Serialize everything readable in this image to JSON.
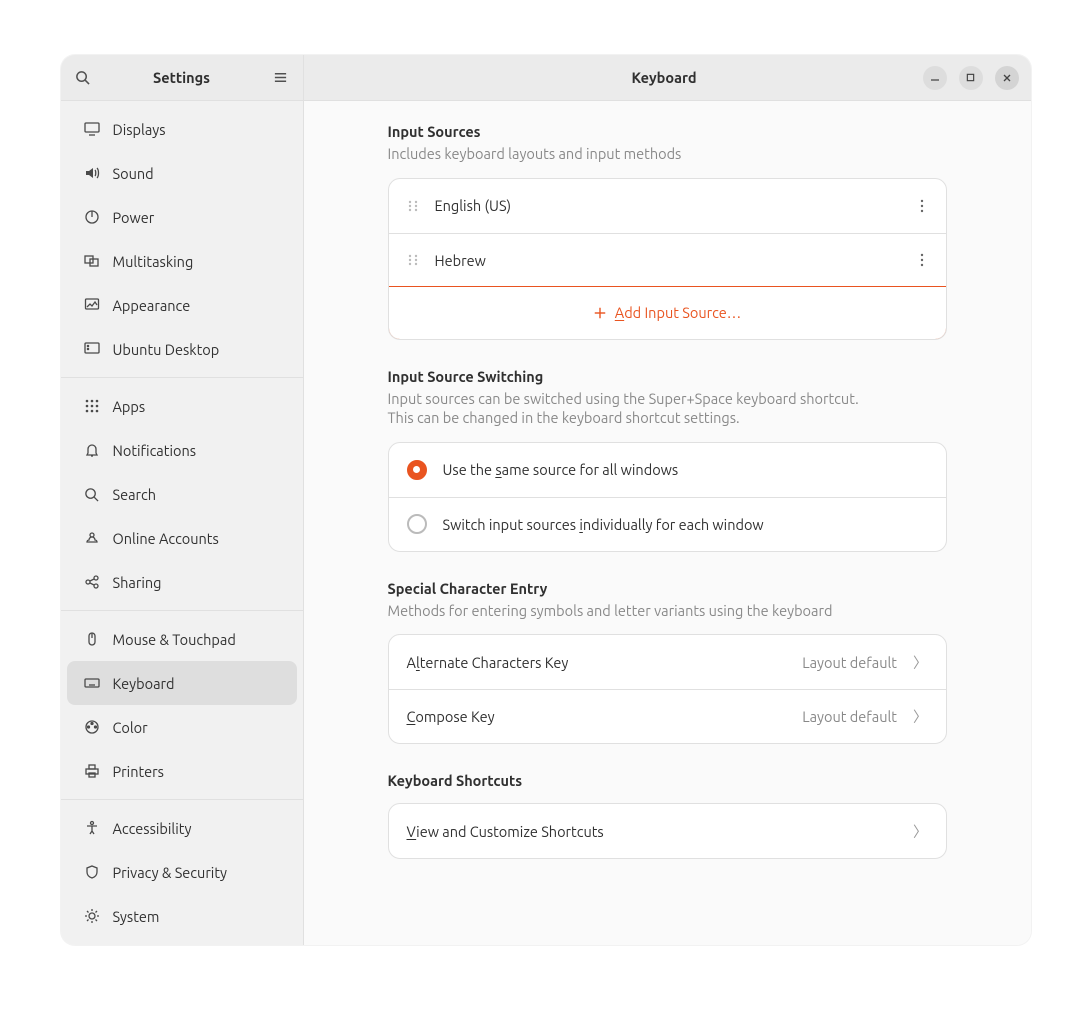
{
  "sidebar": {
    "title": "Settings",
    "groups": [
      [
        "Displays",
        "Sound",
        "Power",
        "Multitasking",
        "Appearance",
        "Ubuntu Desktop"
      ],
      [
        "Apps",
        "Notifications",
        "Search",
        "Online Accounts",
        "Sharing"
      ],
      [
        "Mouse & Touchpad",
        "Keyboard",
        "Color",
        "Printers"
      ],
      [
        "Accessibility",
        "Privacy & Security",
        "System"
      ]
    ],
    "selected": "Keyboard"
  },
  "header": {
    "title": "Keyboard"
  },
  "input_sources": {
    "title": "Input Sources",
    "desc": "Includes keyboard layouts and input methods",
    "items": [
      "English (US)",
      "Hebrew"
    ],
    "add_pre": "A",
    "add_post": "dd Input Source…"
  },
  "switching": {
    "title": "Input Source Switching",
    "desc1": "Input sources can be switched using the Super+Space keyboard shortcut.",
    "desc2": "This can be changed in the keyboard shortcut settings.",
    "opt1_pre": "Use the ",
    "opt1_u": "s",
    "opt1_post": "ame source for all windows",
    "opt2_pre": "Switch input sources ",
    "opt2_u": "i",
    "opt2_post": "ndividually for each window",
    "selected": 0
  },
  "special": {
    "title": "Special Character Entry",
    "desc": "Methods for entering symbols and letter variants using the keyboard",
    "rows": [
      {
        "pre": "A",
        "u": "l",
        "post": "ternate Characters Key",
        "value": "Layout default"
      },
      {
        "pre": "",
        "u": "C",
        "post": "ompose Key",
        "value": "Layout default"
      }
    ]
  },
  "shortcuts": {
    "title": "Keyboard Shortcuts",
    "row_pre": "",
    "row_u": "V",
    "row_post": "iew and Customize Shortcuts"
  }
}
